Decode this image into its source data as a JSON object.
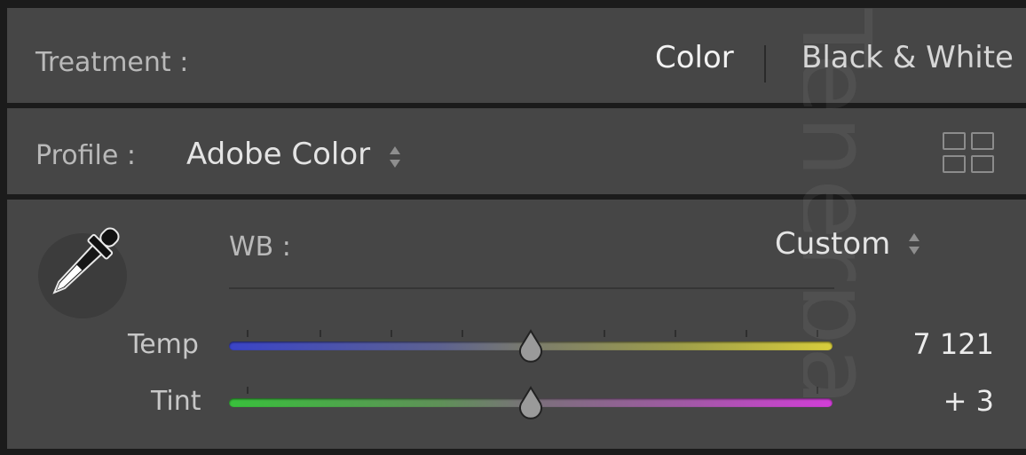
{
  "treatment": {
    "label": "Treatment :",
    "options": [
      "Color",
      "Black & White"
    ],
    "selected": "Color"
  },
  "profile": {
    "label": "Profile :",
    "value": "Adobe Color",
    "browse_icon": "grid-icon"
  },
  "white_balance": {
    "eyedropper_icon": "eyedropper-icon",
    "label": "WB :",
    "value": "Custom",
    "sliders": [
      {
        "label": "Temp",
        "value": "7 121",
        "position": 0.5
      },
      {
        "label": "Tint",
        "value": "+ 3",
        "position": 0.5
      }
    ]
  },
  "watermark": "Tenerpa",
  "colors": {
    "panel_bg": "#464646",
    "frame_bg": "#1b1b1b",
    "temp_start": "#3a44c8",
    "temp_end": "#d8cd3c",
    "tint_start": "#39c03c",
    "tint_end": "#d23ed8"
  }
}
